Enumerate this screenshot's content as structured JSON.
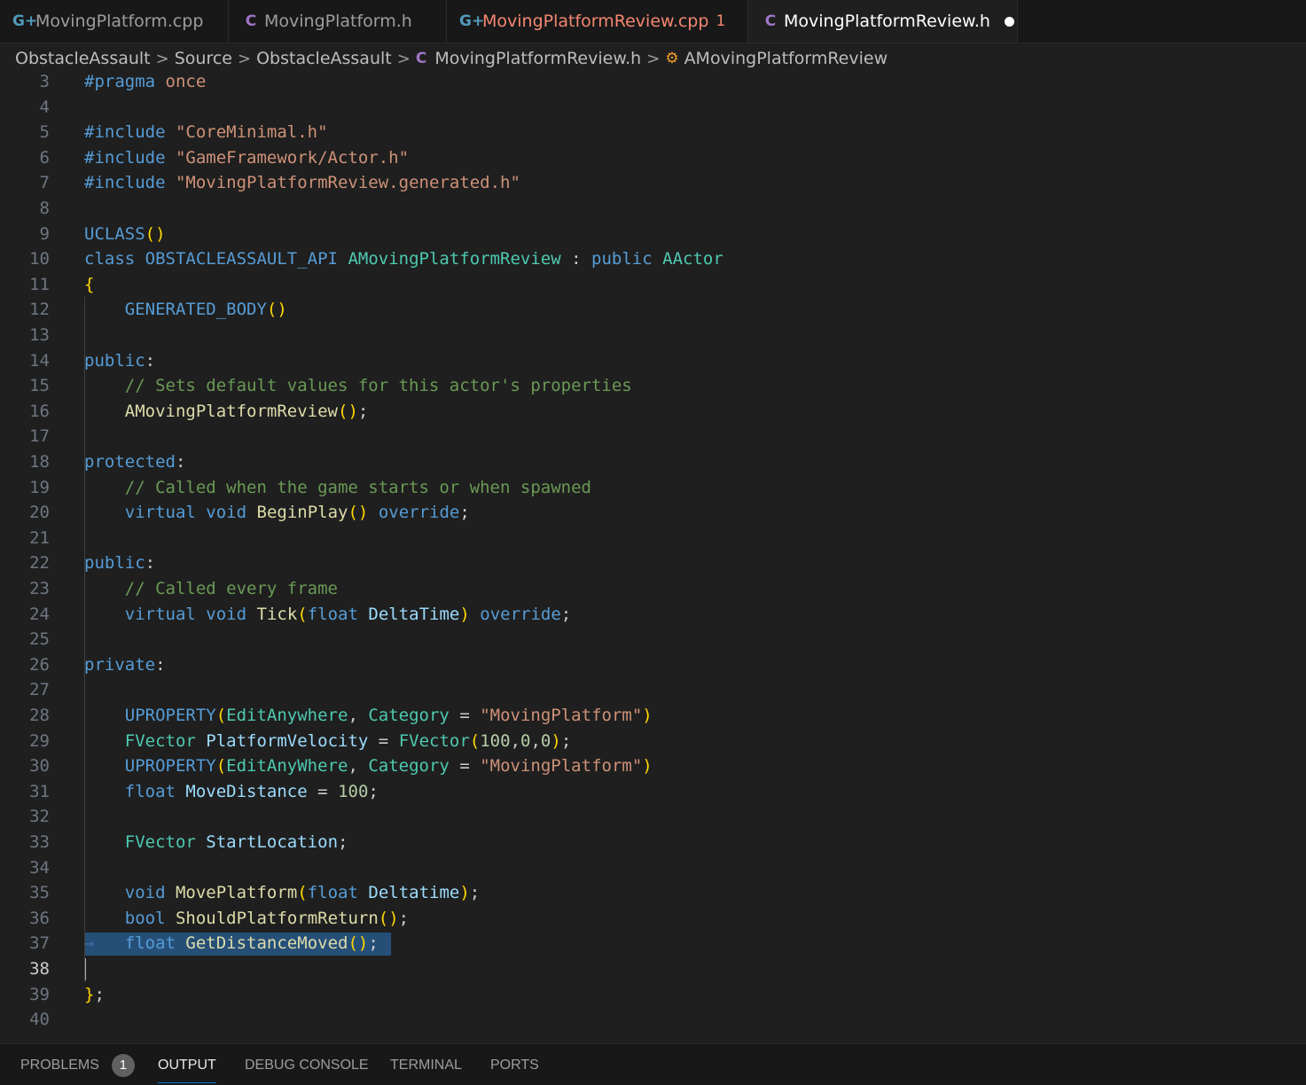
{
  "tabs": [
    {
      "label": "MovingPlatform.cpp",
      "icon": "cpp-file-icon",
      "icon_glyph": "G+",
      "state": "inactive"
    },
    {
      "label": "MovingPlatform.h",
      "icon": "header-file-icon",
      "icon_glyph": "C",
      "state": "inactive"
    },
    {
      "label": "MovingPlatformReview.cpp",
      "icon": "cpp-file-icon",
      "icon_glyph": "G+",
      "state": "error",
      "problem_count": "1"
    },
    {
      "label": "MovingPlatformReview.h",
      "icon": "header-file-icon",
      "icon_glyph": "C",
      "state": "active-unsaved"
    }
  ],
  "breadcrumb": {
    "items": [
      "ObstacleAssault",
      "Source",
      "ObstacleAssault",
      "MovingPlatformReview.h",
      "AMovingPlatformReview"
    ],
    "file_icon_glyph": "C",
    "class_icon_glyph": "⚙"
  },
  "editor": {
    "cursor_line": "38",
    "selected_line": "37",
    "lines": [
      {
        "n": "3",
        "text": "#pragma once"
      },
      {
        "n": "4",
        "text": ""
      },
      {
        "n": "5",
        "text": "#include \"CoreMinimal.h\""
      },
      {
        "n": "6",
        "text": "#include \"GameFramework/Actor.h\""
      },
      {
        "n": "7",
        "text": "#include \"MovingPlatformReview.generated.h\""
      },
      {
        "n": "8",
        "text": ""
      },
      {
        "n": "9",
        "text": "UCLASS()"
      },
      {
        "n": "10",
        "text": "class OBSTACLEASSAULT_API AMovingPlatformReview : public AActor"
      },
      {
        "n": "11",
        "text": "{"
      },
      {
        "n": "12",
        "text": "    GENERATED_BODY()"
      },
      {
        "n": "13",
        "text": ""
      },
      {
        "n": "14",
        "text": "public:"
      },
      {
        "n": "15",
        "text": "    // Sets default values for this actor's properties"
      },
      {
        "n": "16",
        "text": "    AMovingPlatformReview();"
      },
      {
        "n": "17",
        "text": ""
      },
      {
        "n": "18",
        "text": "protected:"
      },
      {
        "n": "19",
        "text": "    // Called when the game starts or when spawned"
      },
      {
        "n": "20",
        "text": "    virtual void BeginPlay() override;"
      },
      {
        "n": "21",
        "text": ""
      },
      {
        "n": "22",
        "text": "public:"
      },
      {
        "n": "23",
        "text": "    // Called every frame"
      },
      {
        "n": "24",
        "text": "    virtual void Tick(float DeltaTime) override;"
      },
      {
        "n": "25",
        "text": ""
      },
      {
        "n": "26",
        "text": "private:"
      },
      {
        "n": "27",
        "text": ""
      },
      {
        "n": "28",
        "text": "    UPROPERTY(EditAnywhere, Category = \"MovingPlatform\")"
      },
      {
        "n": "29",
        "text": "    FVector PlatformVelocity = FVector(100,0,0);"
      },
      {
        "n": "30",
        "text": "    UPROPERTY(EditAnyWhere, Category = \"MovingPlatform\")"
      },
      {
        "n": "31",
        "text": "    float MoveDistance = 100;"
      },
      {
        "n": "32",
        "text": ""
      },
      {
        "n": "33",
        "text": "    FVector StartLocation;"
      },
      {
        "n": "34",
        "text": ""
      },
      {
        "n": "35",
        "text": "    void MovePlatform(float Deltatime);"
      },
      {
        "n": "36",
        "text": "    bool ShouldPlatformReturn();"
      },
      {
        "n": "37",
        "text": "    float GetDistanceMoved();"
      },
      {
        "n": "38",
        "text": ""
      },
      {
        "n": "39",
        "text": "};"
      },
      {
        "n": "40",
        "text": ""
      }
    ]
  },
  "panel_tabs": [
    {
      "label": "PROBLEMS",
      "badge": "1"
    },
    {
      "label": "OUTPUT",
      "active": true
    },
    {
      "label": "DEBUG CONSOLE"
    },
    {
      "label": "TERMINAL"
    },
    {
      "label": "PORTS"
    }
  ],
  "colors": {
    "background": "#1f1f1f",
    "tab_bar": "#181818",
    "selection": "#264f78",
    "error_text": "#f48771",
    "keyword": "#569cd6",
    "string": "#ce9178",
    "type": "#4ec9b0",
    "function": "#dcdcaa",
    "variable": "#9cdcfe",
    "comment": "#6a9955",
    "number": "#b5cea8"
  }
}
